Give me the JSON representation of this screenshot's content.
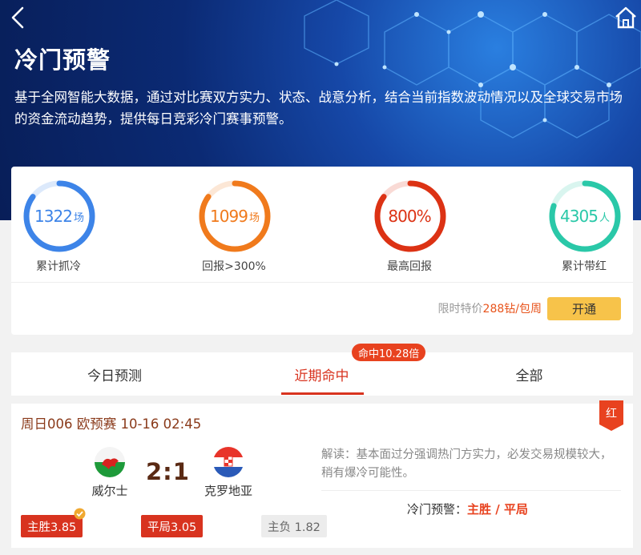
{
  "header": {
    "title": "冷门预警",
    "description": "基于全网智能大数据，通过对比赛双方实力、状态、战意分析，结合当前指数波动情况以及全球交易市场的资金流动趋势，提供每日竞彩冷门赛事预警。"
  },
  "stats": [
    {
      "value": "1322",
      "unit": "场",
      "label": "累计抓冷",
      "progress": 0.85,
      "color": "#3d84e8"
    },
    {
      "value": "1099",
      "unit": "场",
      "label": "回报>300%",
      "progress": 0.85,
      "color": "#f07a1c"
    },
    {
      "value": "800%",
      "unit": "",
      "label": "最高回报",
      "progress": 0.85,
      "color": "#dc3214"
    },
    {
      "value": "4305",
      "unit": "人",
      "label": "累计带红",
      "progress": 0.8,
      "color": "#2ac8a8"
    }
  ],
  "promo": {
    "prefix": "限时特价",
    "price": "288钻/包周",
    "button": "开通"
  },
  "tabs": [
    {
      "label": "今日预测"
    },
    {
      "label": "近期命中"
    },
    {
      "label": "全部"
    }
  ],
  "hit_badge": "命中10.28倍",
  "match": {
    "header": "周日006 欧预赛 10-16 02:45",
    "result_flag": "红",
    "home": "威尔士",
    "away": "克罗地亚",
    "score": "2:1",
    "analysis": "解读：基本面过分强调热门方实力，必发交易规模较大，稍有爆冷可能性。",
    "warning_prefix": "冷门预警：",
    "warning_value": "主胜 / 平局",
    "odds": [
      {
        "label": "主胜3.85"
      },
      {
        "label": "平局3.05"
      },
      {
        "label": "主负 1.82"
      }
    ],
    "colors": {
      "accent": "#d8331f",
      "text_brown": "#8a3a1a"
    }
  }
}
